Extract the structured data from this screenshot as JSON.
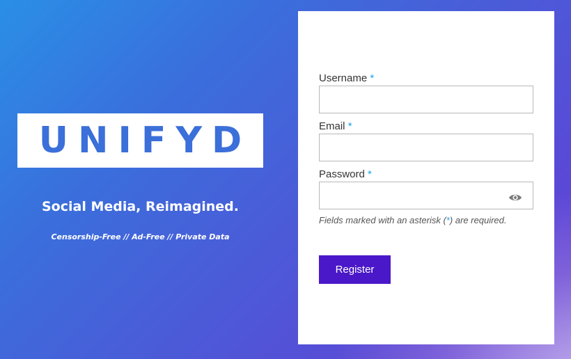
{
  "brand": {
    "logo_text": "UNIFYD",
    "tagline": "Social Media, Reimagined.",
    "subtagline": "Censorship-Free // Ad-Free // Private Data"
  },
  "form": {
    "username_label": "Username",
    "email_label": "Email",
    "password_label": "Password",
    "required_marker": "*",
    "username_value": "",
    "email_value": "",
    "password_value": "",
    "password_toggle_icon": "eye-icon",
    "hint_prefix": "Fields marked with an asterisk (",
    "hint_marker": "*",
    "hint_suffix": ") are required.",
    "register_label": "Register"
  },
  "colors": {
    "logo_text": "#3b6fd9",
    "required_marker": "#1aa3e8",
    "register_button": "#4a18c8"
  }
}
